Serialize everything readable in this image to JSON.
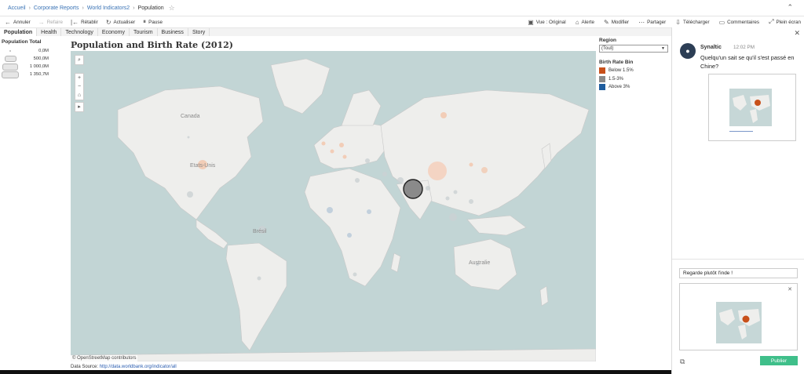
{
  "breadcrumb": {
    "items": [
      "Accueil",
      "Corporate Reports",
      "World Indicators2"
    ],
    "current": "Population"
  },
  "toolbar": {
    "left": [
      {
        "label": "Annuler",
        "icon": "undo-icon",
        "enabled": true
      },
      {
        "label": "Refaire",
        "icon": "redo-icon",
        "enabled": false
      },
      {
        "label": "Rétablir",
        "icon": "revert-icon",
        "enabled": true
      },
      {
        "label": "Actualiser",
        "icon": "refresh-icon",
        "enabled": true
      },
      {
        "label": "Pause",
        "icon": "pause-icon",
        "enabled": true
      }
    ],
    "right": [
      {
        "label": "Vue : Original",
        "icon": "view-icon"
      },
      {
        "label": "Alerte",
        "icon": "alert-icon"
      },
      {
        "label": "Modifier",
        "icon": "edit-icon"
      },
      {
        "label": "Partager",
        "icon": "share-icon"
      },
      {
        "label": "Télécharger",
        "icon": "download-icon"
      },
      {
        "label": "Commentaires",
        "icon": "comment-icon"
      },
      {
        "label": "Plein écran",
        "icon": "fullscreen-icon"
      }
    ]
  },
  "tabs": [
    "Population",
    "Health",
    "Technology",
    "Economy",
    "Tourism",
    "Business",
    "Story"
  ],
  "active_tab": "Population",
  "viz": {
    "title": "Population and Birth Rate (2012)",
    "size_legend": {
      "title": "Population Total",
      "items": [
        "0,0M",
        "500,0M",
        "1 000,0M",
        "1 350,7M"
      ]
    },
    "region": {
      "title": "Region",
      "selected": "(Tout)"
    },
    "birth_rate": {
      "title": "Birth Rate Bin",
      "items": [
        {
          "label": "Below 1.5%",
          "color": "#c8501a"
        },
        {
          "label": "1.5-3%",
          "color": "#8a8a8a"
        },
        {
          "label": "Above 3%",
          "color": "#1f5d9e"
        }
      ]
    },
    "map_labels": {
      "canada": "Canada",
      "usa": "Etats-Unis",
      "brazil": "Brésil",
      "australia": "Australie"
    },
    "attribution": "© OpenStreetMap contributors",
    "source_label": "Data Source:",
    "source_url": "http://data.worldbank.org/indicator/all"
  },
  "comments": {
    "author": "Synaltic",
    "time": "12:02 PM",
    "text": "Quelqu'un sait se qu'il s'est passé en Chine?",
    "reply_value": "Regarde plutôt l'inde !",
    "publish_label": "Publier"
  }
}
